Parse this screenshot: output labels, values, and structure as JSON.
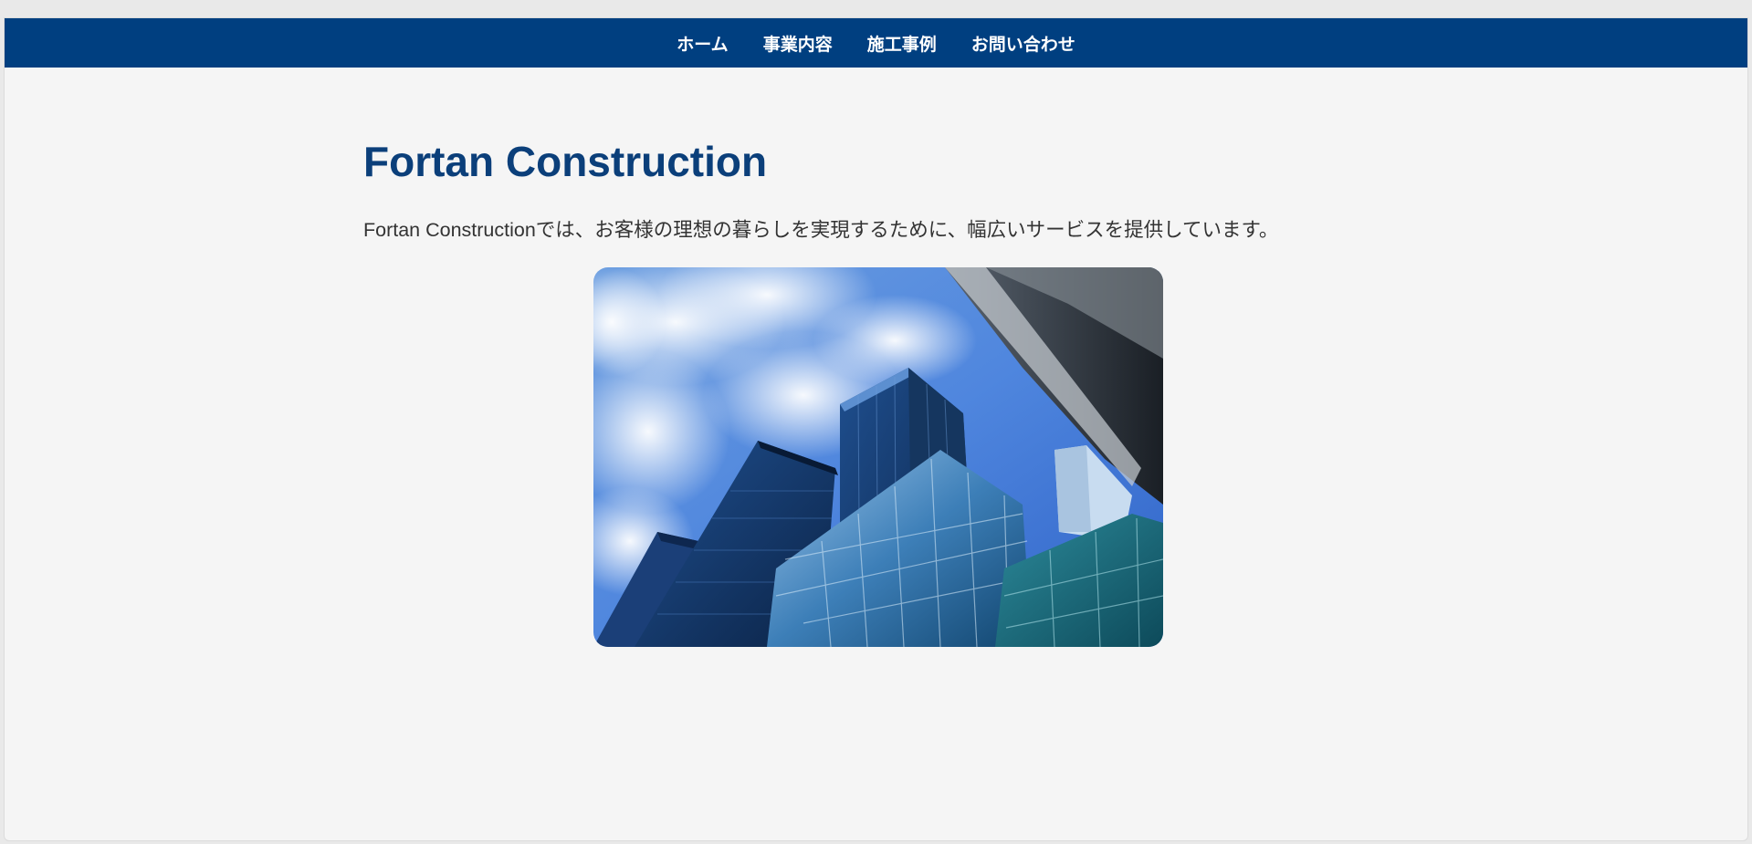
{
  "nav": {
    "items": [
      {
        "label": "ホーム"
      },
      {
        "label": "事業内容"
      },
      {
        "label": "施工事例"
      },
      {
        "label": "お問い合わせ"
      }
    ]
  },
  "main": {
    "title": "Fortan Construction",
    "intro": "Fortan Constructionでは、お客様の理想の暮らしを実現するために、幅広いサービスを提供しています。",
    "hero_image_icon": "skyscrapers-photo"
  },
  "colors": {
    "nav_background": "#003f80",
    "title": "#0b3f7a",
    "body_text": "#333333",
    "page_background": "#f5f5f5"
  }
}
